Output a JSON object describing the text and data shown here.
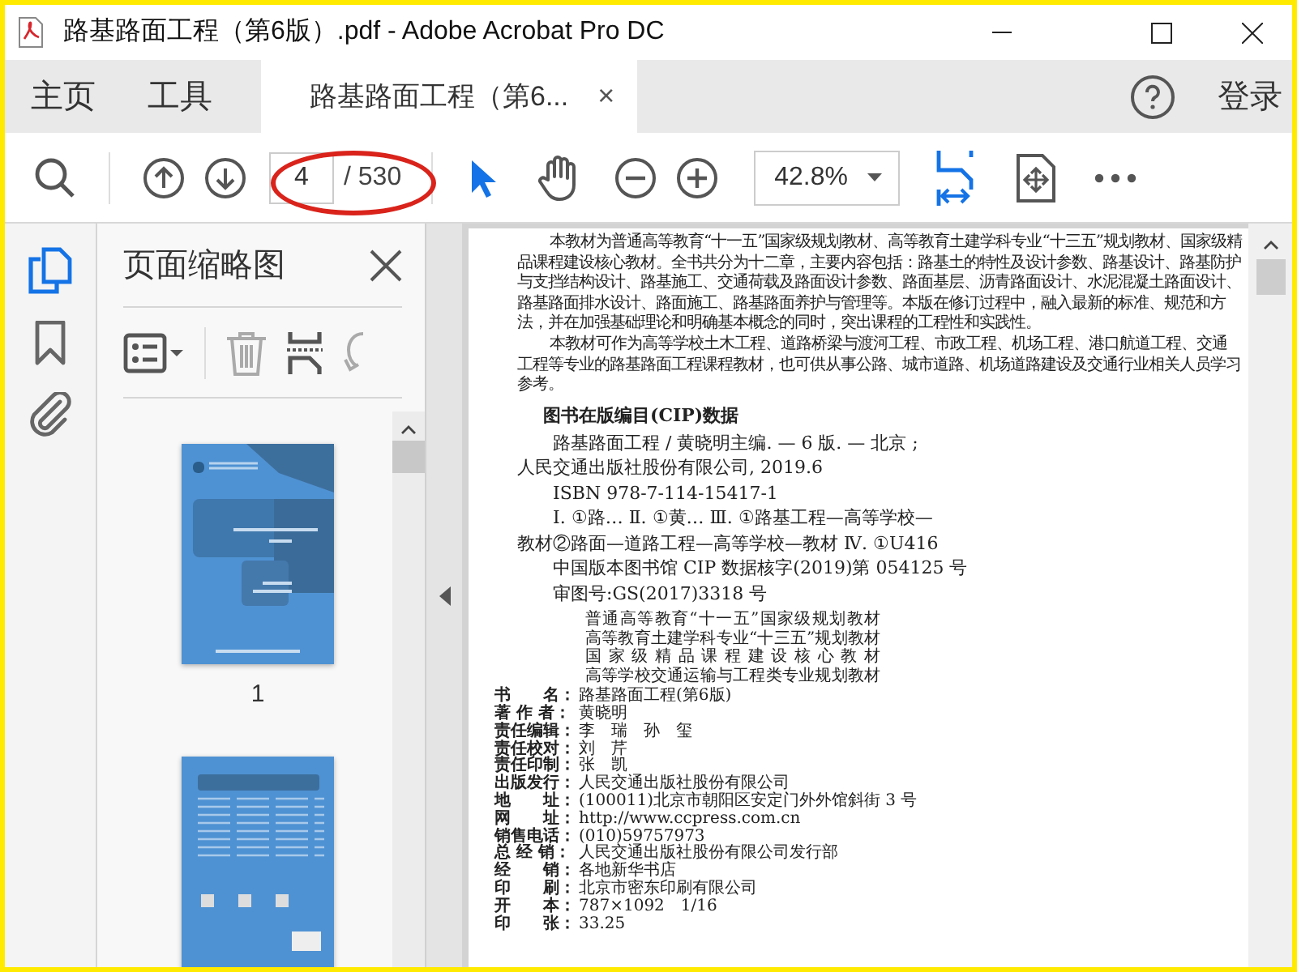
{
  "window": {
    "title": "路基路面工程（第6版）.pdf - Adobe Acrobat Pro DC"
  },
  "tabs": [
    {
      "label": "主页",
      "selected": false
    },
    {
      "label": "工具",
      "selected": false
    },
    {
      "label": "路基路面工程（第6...",
      "selected": true,
      "close": "×"
    }
  ],
  "sign_in": "登录",
  "toolbar": {
    "page_number": "4",
    "page_count": "/ 530",
    "zoom": "42.8%"
  },
  "rail": [
    {
      "kind": "pages",
      "selected": true
    },
    {
      "kind": "bookmarks",
      "selected": false
    },
    {
      "kind": "attachments",
      "selected": false
    }
  ],
  "side_panel": {
    "title": "页面缩略图",
    "thumbnails": [
      {
        "kind": "cover",
        "label": "1"
      },
      {
        "kind": "back-cover"
      }
    ]
  },
  "document": {
    "paragraphs": [
      "本教材为普通高等教育“十一五”国家级规划教材、高等教育土建学科专业“十三五”规划教材、国家级精品课程建设核心教材。全书共分为十二章，主要内容包括：路基土的特性及设计参数、路基设计、路基防护与支挡结构设计、路基施工、交通荷载及路面设计参数、路面基层、沥青路面设计、水泥混凝土路面设计、路基路面排水设计、路面施工、路基路面养护与管理等。本版在修订过程中，融入最新的标准、规范和方法，并在加强基础理论和明确基本概念的同时，突出课程的工程性和实践性。",
      "本教材可作为高等学校土木工程、道路桥梁与渡河工程、市政工程、机场工程、港口航道工程、交通工程等专业的路基路面工程课程教材，也可供从事公路、城市道路、机场道路建设及交通行业相关人员学习参考。"
    ],
    "cip_heading": "图书在版编目(CIP)数据",
    "cip_lines": [
      {
        "text": "路基路面工程 / 黄晓明主编. — 6 版. — 北京 ;",
        "indent": true
      },
      {
        "text": "人民交通出版社股份有限公司, 2019.6",
        "indent": false
      },
      {
        "text": "ISBN 978-7-114-15417-1",
        "indent": true
      },
      {
        "text": "Ⅰ. ①路…  Ⅱ. ①黄…  Ⅲ. ①路基工程—高等学校—",
        "indent": true
      },
      {
        "text": "教材②路面—道路工程—高等学校—教材  Ⅳ. ①U416",
        "indent": false
      },
      {
        "text": "中国版本图书馆 CIP 数据核字(2019)第 054125 号",
        "indent": true
      },
      {
        "text": "审图号:GS(2017)3318 号",
        "indent": true
      }
    ],
    "series": [
      "普通高等教育“十一五”国家级规划教材",
      "高等教育土建学科专业“十三五”规划教材",
      "国 家 级 精 品 课 程 建 设 核 心 教 材",
      "高等学校交通运输与工程类专业规划教材"
    ],
    "colophon": [
      {
        "label": "书　　名：",
        "value": "路基路面工程(第6版)"
      },
      {
        "label": "著 作 者：",
        "value": "黄晓明"
      },
      {
        "label": "责任编辑：",
        "value": "李　瑞　孙　玺"
      },
      {
        "label": "责任校对：",
        "value": "刘　芹"
      },
      {
        "label": "责任印制：",
        "value": "张　凯"
      },
      {
        "label": "出版发行：",
        "value": "人民交通出版社股份有限公司"
      },
      {
        "label": "地　　址：",
        "value": "(100011)北京市朝阳区安定门外外馆斜街 3 号"
      },
      {
        "label": "网　　址：",
        "value": "http://www.ccpress.com.cn"
      },
      {
        "label": "销售电话：",
        "value": "(010)59757973"
      },
      {
        "label": "总 经 销：",
        "value": "人民交通出版社股份有限公司发行部"
      },
      {
        "label": "经　　销：",
        "value": "各地新华书店"
      },
      {
        "label": "印　　刷：",
        "value": "北京市密东印刷有限公司"
      },
      {
        "label": "开　　本：",
        "value": "787×1092　1/16"
      },
      {
        "label": "印　　张：",
        "value": "33.25"
      }
    ]
  }
}
